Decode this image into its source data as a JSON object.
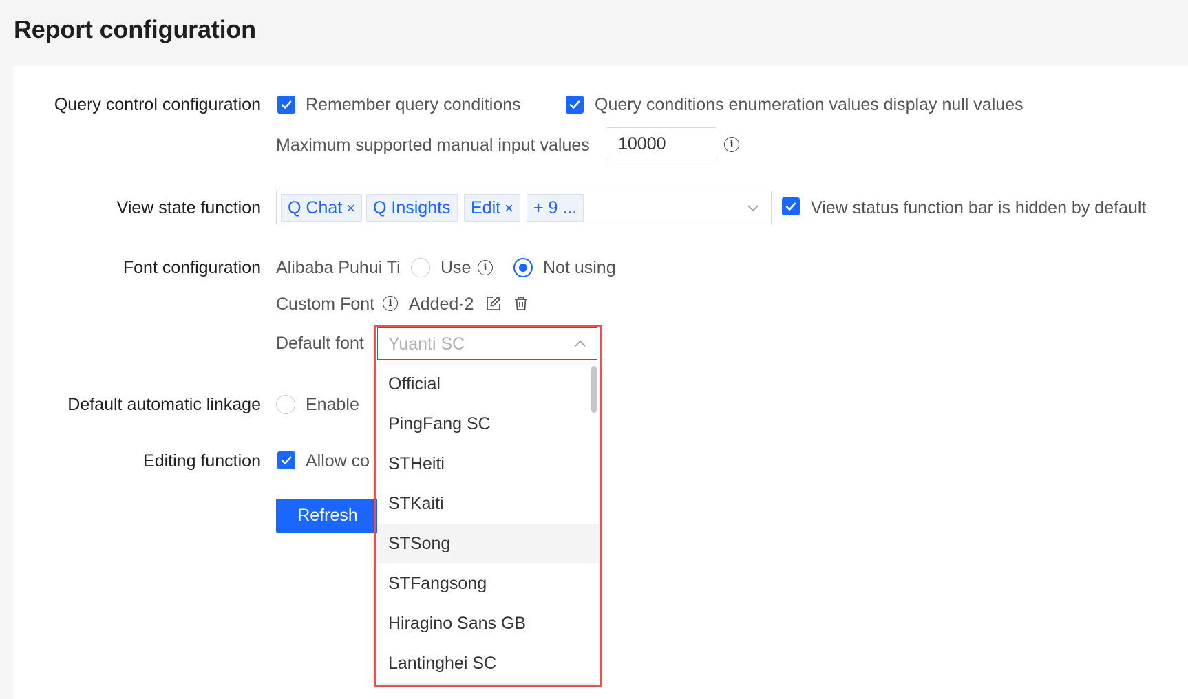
{
  "page": {
    "title": "Report configuration"
  },
  "query_control": {
    "label": "Query control configuration",
    "remember_label": "Remember query conditions",
    "remember_checked": true,
    "null_values_label": "Query conditions enumeration values display null values",
    "null_values_checked": true,
    "max_input_label": "Maximum supported manual input values",
    "max_input_value": "10000"
  },
  "view_state": {
    "label": "View state function",
    "tags": [
      {
        "text": "Q Chat",
        "closable": true
      },
      {
        "text": "Q Insights",
        "closable": false
      },
      {
        "text": "Edit",
        "closable": true
      },
      {
        "text": "+ 9 ...",
        "closable": false
      }
    ],
    "hidden_default_label": "View status function bar is hidden by default",
    "hidden_default_checked": true
  },
  "font_config": {
    "label": "Font configuration",
    "alibaba_label": "Alibaba Puhui Ti",
    "use_label": "Use",
    "not_using_label": "Not using",
    "selected": "Not using",
    "custom_font_label": "Custom Font",
    "added_text": "Added·2",
    "default_font_label": "Default font",
    "default_font_placeholder": "Yuanti SC",
    "dropdown_options": [
      "Official",
      "PingFang SC",
      "STHeiti",
      "STKaiti",
      "STSong",
      "STFangsong",
      "Hiragino Sans GB",
      "Lantinghei SC"
    ],
    "hovered_option": "STSong"
  },
  "linkage": {
    "label": "Default automatic linkage",
    "enable_label": "Enable"
  },
  "editing": {
    "label": "Editing function",
    "allow_label": "Allow co",
    "allow_checked": true
  },
  "actions": {
    "refresh_label": "Refresh"
  },
  "colors": {
    "accent": "#1a66ff",
    "highlight": "#e8514c"
  }
}
